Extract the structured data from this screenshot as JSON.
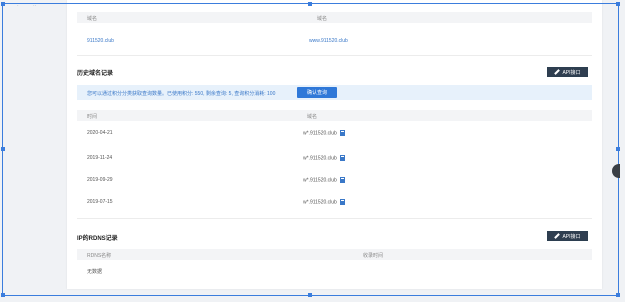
{
  "top_fragments": [
    "·",
    "··"
  ],
  "domains_table": {
    "headers": [
      "域名",
      "域名"
    ],
    "row": [
      "911520.club",
      "www.911520.club"
    ]
  },
  "history": {
    "title": "历史域名记录",
    "api_label": "API接口",
    "notice": "您可以通过积分分类获取查询数量。已使用积分: 550, 剩余查询: 5, 查询积分消耗: 100",
    "query_button": "确认查询",
    "headers": [
      "时间",
      "域名"
    ],
    "rows": [
      {
        "date": "2020-04-21",
        "domain": "w*.911520.club"
      },
      {
        "date": "2019-11-24",
        "domain": "w*.911520.club"
      },
      {
        "date": "2019-09-29",
        "domain": "w*.911520.club"
      },
      {
        "date": "2019-07-15",
        "domain": "w*.911520.club"
      }
    ]
  },
  "rdns": {
    "title": "IP的RDNS记录",
    "api_label": "API接口",
    "headers": [
      "RDNS名称",
      "收录时间"
    ],
    "empty": "无数据"
  }
}
